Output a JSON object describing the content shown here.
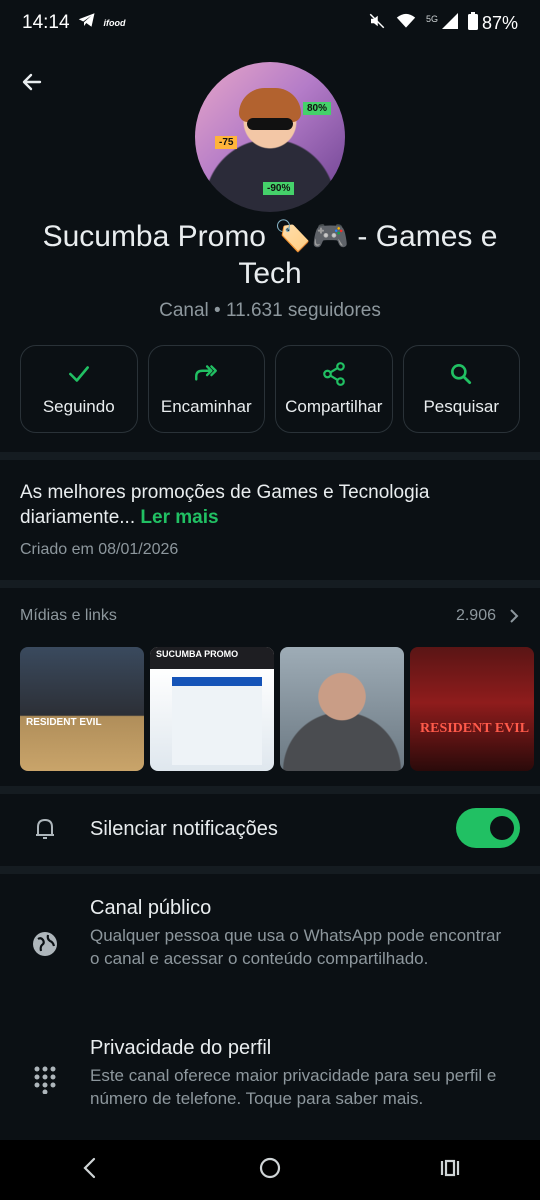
{
  "status_bar": {
    "time": "14:14",
    "carrier_badge": "ifood",
    "network_label": "5G",
    "battery": "87%",
    "icons": [
      "telegram-icon",
      "ifood-icon",
      "mute-icon",
      "wifi-icon",
      "signal-icon",
      "battery-icon"
    ]
  },
  "header": {
    "back_icon": "arrow-left-icon",
    "avatar_tags": [
      "80%",
      "-90%",
      "-75"
    ]
  },
  "channel": {
    "name": "Sucumba Promo 🏷️🎮  - Games e Tech",
    "meta": "Canal • 11.631 seguidores"
  },
  "actions": [
    {
      "label": "Seguindo",
      "icon": "check-icon"
    },
    {
      "label": "Encaminhar",
      "icon": "forward-icon"
    },
    {
      "label": "Compartilhar",
      "icon": "share-icon"
    },
    {
      "label": "Pesquisar",
      "icon": "search-icon"
    }
  ],
  "description": {
    "text": "As melhores promoções de Games e Tecnologia diariamente...",
    "more": "Ler mais",
    "created": "Criado em 08/01/2026"
  },
  "media": {
    "title": "Mídias e links",
    "count": "2.906",
    "thumbs": [
      {
        "caption": "RESIDENT EVIL"
      },
      {
        "caption": "SUCUMBA PROMO"
      },
      {
        "caption": ""
      },
      {
        "caption": "RESIDENT EVIL"
      }
    ]
  },
  "mute": {
    "label": "Silenciar notificações",
    "enabled": true
  },
  "settings": [
    {
      "title": "Canal público",
      "subtitle": "Qualquer pessoa que usa o WhatsApp pode encontrar o canal e acessar o conteúdo compartilhado.",
      "icon": "globe-icon"
    },
    {
      "title": "Privacidade do perfil",
      "subtitle": "Este canal oferece maior privacidade para seu perfil e número de telefone. Toque para saber mais.",
      "icon": "dialpad-icon"
    }
  ],
  "colors": {
    "background": "#0b1014",
    "accent": "#21c063",
    "secondary_text": "#8d979d",
    "border": "#2a3238"
  }
}
